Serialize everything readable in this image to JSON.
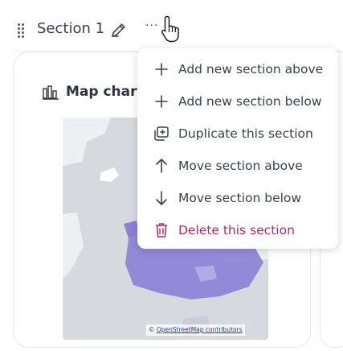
{
  "section": {
    "title": "Section 1",
    "edit_icon": "pencil-icon",
    "more_icon": "more-horizontal-icon",
    "more_label": "···"
  },
  "card": {
    "title": "Map chart",
    "icon": "map-chart-icon",
    "attribution_prefix": "©",
    "attribution_link": "OpenStreetMap contributors"
  },
  "menu": {
    "items": [
      {
        "label": "Add new section above",
        "icon": "plus-icon"
      },
      {
        "label": "Add new section below",
        "icon": "plus-icon"
      },
      {
        "label": "Duplicate this section",
        "icon": "duplicate-icon"
      },
      {
        "label": "Move section above",
        "icon": "arrow-up-icon"
      },
      {
        "label": "Move section below",
        "icon": "arrow-down-icon"
      },
      {
        "label": "Delete this section",
        "icon": "trash-icon"
      }
    ]
  },
  "colors": {
    "danger": "#c0245c",
    "map_region": "#8b7fd6",
    "map_background": "#d6d9de"
  }
}
